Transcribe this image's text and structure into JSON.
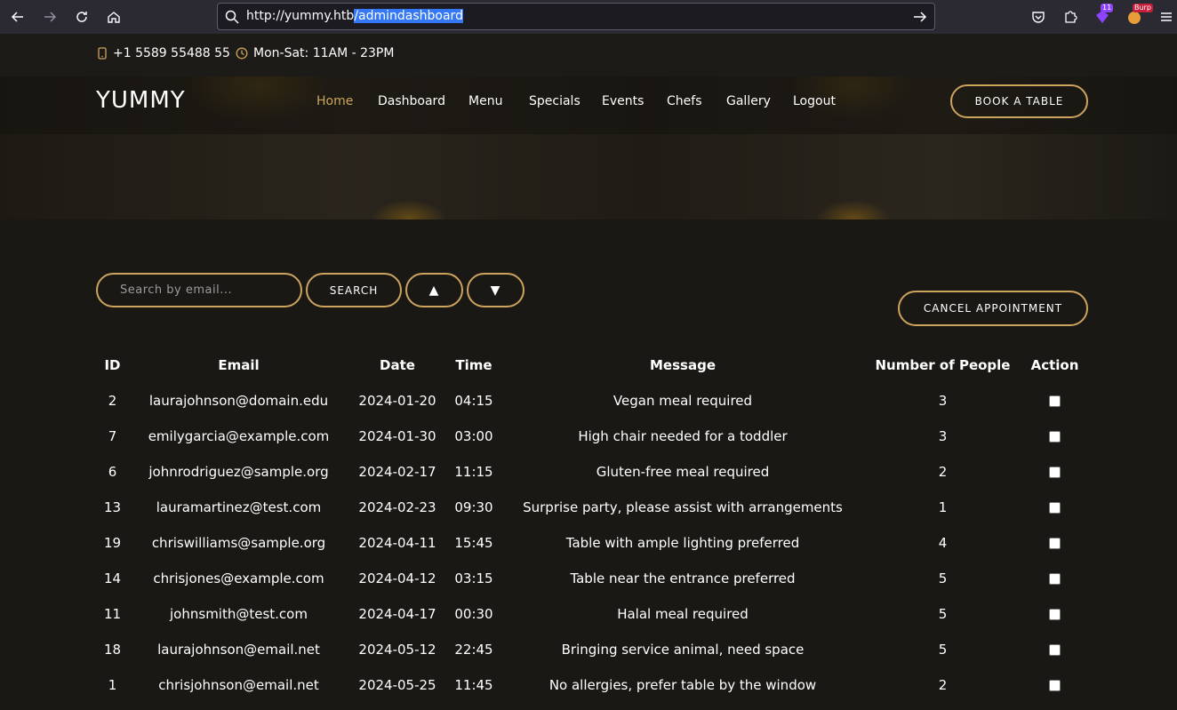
{
  "browser": {
    "url_prefix": "http://yummy.htb",
    "url_selected": "/admindashboard",
    "extension_badge_1": "11",
    "extension_badge_2": "Burp"
  },
  "topbar": {
    "phone": "+1 5589 55488 55",
    "hours": "Mon-Sat: 11AM - 23PM"
  },
  "header": {
    "logo": "YUMMY",
    "menu": [
      "Home",
      "Dashboard",
      "Menu",
      "Specials",
      "Events",
      "Chefs",
      "Gallery",
      "Logout"
    ],
    "book_button": "BOOK A TABLE"
  },
  "controls": {
    "search_placeholder": "Search by email...",
    "search_button": "SEARCH",
    "sort_asc": "▲",
    "sort_desc": "▼",
    "cancel_button": "CANCEL APPOINTMENT"
  },
  "table": {
    "columns": [
      "ID",
      "Email",
      "Date",
      "Time",
      "Message",
      "Number of People",
      "Action"
    ],
    "rows": [
      {
        "id": "2",
        "email": "laurajohnson@domain.edu",
        "date": "2024-01-20",
        "time": "04:15",
        "message": "Vegan meal required",
        "people": "3"
      },
      {
        "id": "7",
        "email": "emilygarcia@example.com",
        "date": "2024-01-30",
        "time": "03:00",
        "message": "High chair needed for a toddler",
        "people": "3"
      },
      {
        "id": "6",
        "email": "johnrodriguez@sample.org",
        "date": "2024-02-17",
        "time": "11:15",
        "message": "Gluten-free meal required",
        "people": "2"
      },
      {
        "id": "13",
        "email": "lauramartinez@test.com",
        "date": "2024-02-23",
        "time": "09:30",
        "message": "Surprise party, please assist with arrangements",
        "people": "1"
      },
      {
        "id": "19",
        "email": "chriswilliams@sample.org",
        "date": "2024-04-11",
        "time": "15:45",
        "message": "Table with ample lighting preferred",
        "people": "4"
      },
      {
        "id": "14",
        "email": "chrisjones@example.com",
        "date": "2024-04-12",
        "time": "03:15",
        "message": "Table near the entrance preferred",
        "people": "5"
      },
      {
        "id": "11",
        "email": "johnsmith@test.com",
        "date": "2024-04-17",
        "time": "00:30",
        "message": "Halal meal required",
        "people": "5"
      },
      {
        "id": "18",
        "email": "laurajohnson@email.net",
        "date": "2024-05-12",
        "time": "22:45",
        "message": "Bringing service animal, need space",
        "people": "5"
      },
      {
        "id": "1",
        "email": "chrisjohnson@email.net",
        "date": "2024-05-25",
        "time": "11:45",
        "message": "No allergies, prefer table by the window",
        "people": "2"
      }
    ]
  },
  "colors": {
    "accent": "#cda45e",
    "background": "#1a1814",
    "browser_chrome": "#2b2a33"
  }
}
